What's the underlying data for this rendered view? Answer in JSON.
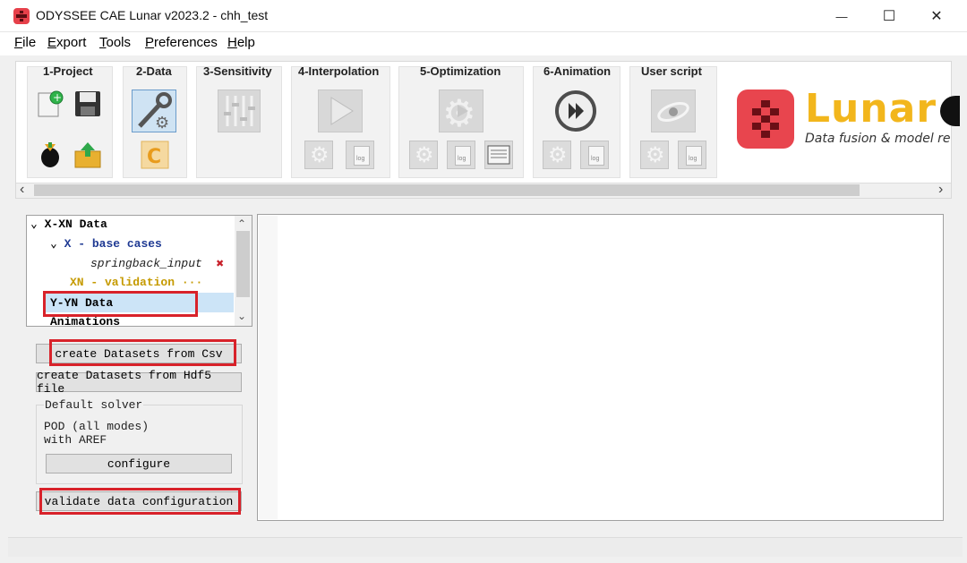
{
  "window": {
    "title": "ODYSSEE CAE Lunar v2023.2 - chh_test",
    "minimize_glyph": "—",
    "maximize_glyph": "☐",
    "close_glyph": "✕"
  },
  "menu": {
    "items": [
      {
        "acc": "F",
        "rest": "ile"
      },
      {
        "acc": "E",
        "rest": "xport"
      },
      {
        "acc": "T",
        "rest": "ools"
      },
      {
        "acc": "P",
        "rest": "references"
      },
      {
        "acc": "H",
        "rest": "elp"
      }
    ]
  },
  "toolbar": {
    "groups": [
      {
        "label": "1-Project"
      },
      {
        "label": "2-Data"
      },
      {
        "label": "3-Sensitivity"
      },
      {
        "label": "4-Interpolation"
      },
      {
        "label": "5-Optimization"
      },
      {
        "label": "6-Animation"
      },
      {
        "label": "User script"
      }
    ],
    "log_text": "log",
    "scroll_left": "‹",
    "scroll_right": "›"
  },
  "brand": {
    "name": "Lunar",
    "tagline": "Data fusion & model rea",
    "accent_color": "#e8454e",
    "name_color": "#f2b61c"
  },
  "tree": {
    "items": [
      {
        "arrow": "⌄",
        "label": "X-XN Data"
      },
      {
        "arrow": "⌄",
        "label": "X - base cases"
      },
      {
        "label": "springback_input",
        "delete_mark": "✖"
      },
      {
        "label": "XN - validation",
        "suffix": "···"
      },
      {
        "label": "Y-YN Data"
      },
      {
        "label": "Animations"
      }
    ],
    "scroll_up": "⌃",
    "scroll_down": "⌄"
  },
  "buttons": {
    "create_csv": "create Datasets from Csv",
    "create_hdf5": "create Datasets from Hdf5 file",
    "configure": "configure",
    "validate": "validate data configuration"
  },
  "solver": {
    "title": "Default solver",
    "line1": "POD (all modes)",
    "line2": "with AREF"
  },
  "colors": {
    "highlight_red": "#d8222a",
    "selection_blue": "#cce4f7",
    "tree_blue": "#1f3a93",
    "tree_gold": "#c59a00"
  }
}
